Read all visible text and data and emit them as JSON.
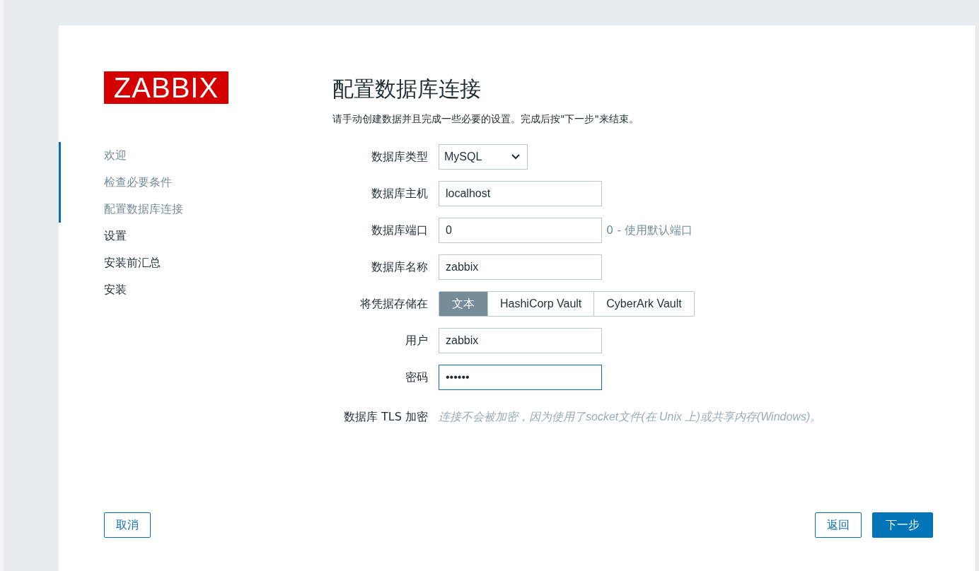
{
  "logo": "ZABBIX",
  "steps": [
    {
      "label": "欢迎",
      "completed": true
    },
    {
      "label": "检查必要条件",
      "completed": true
    },
    {
      "label": "配置数据库连接",
      "completed": true
    },
    {
      "label": "设置",
      "completed": false
    },
    {
      "label": "安装前汇总",
      "completed": false
    },
    {
      "label": "安装",
      "completed": false
    }
  ],
  "title": "配置数据库连接",
  "description": "请手动创建数据并且完成一些必要的设置。完成后按\"下一步\"来结束。",
  "fields": [
    {
      "kind": "select",
      "label": "数据库类型",
      "value": "MySQL"
    },
    {
      "kind": "text",
      "label": "数据库主机",
      "value": "localhost"
    },
    {
      "kind": "text",
      "label": "数据库端口",
      "value": "0",
      "hint": "0 - 使用默认端口"
    },
    {
      "kind": "text",
      "label": "数据库名称",
      "value": "zabbix"
    },
    {
      "kind": "segmented",
      "label": "将凭据存储在",
      "options": [
        {
          "label": "文本",
          "selected": true
        },
        {
          "label": "HashiCorp Vault",
          "selected": false
        },
        {
          "label": "CyberArk Vault",
          "selected": false
        }
      ]
    },
    {
      "kind": "text",
      "label": "用户",
      "value": "zabbix"
    },
    {
      "kind": "password",
      "label": "密码",
      "value": "••••••",
      "focused": true
    },
    {
      "kind": "note",
      "label": "数据库 TLS 加密",
      "value": "连接不会被加密，因为使用了socket文件(在 Unix 上)或共享内存(Windows)。"
    }
  ],
  "buttons": {
    "cancel": "取消",
    "back": "返回",
    "next": "下一步"
  }
}
